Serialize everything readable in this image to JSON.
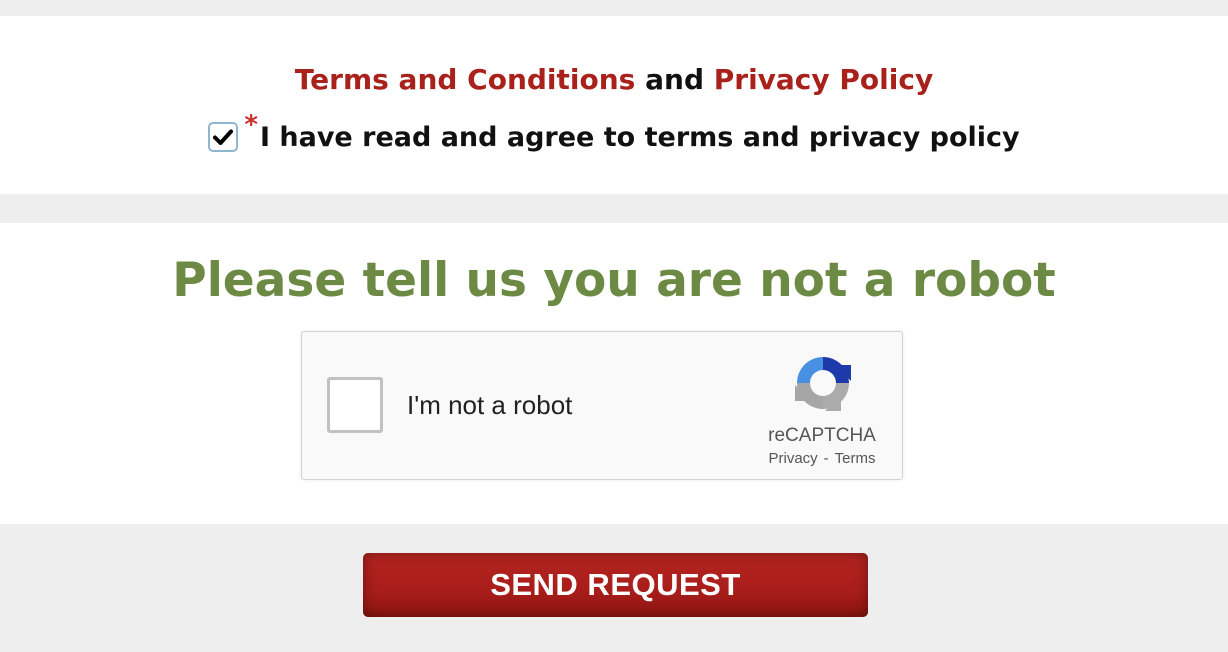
{
  "terms_section": {
    "terms_link": "Terms and Conditions",
    "conjunction": "and",
    "privacy_link": "Privacy Policy",
    "required_marker": "*",
    "agree_label": "I have read and agree to terms and privacy policy",
    "agree_checked": true
  },
  "robot_section": {
    "heading": "Please tell us you are not a robot",
    "recaptcha": {
      "label": "I'm not a robot",
      "brand": "reCAPTCHA",
      "privacy_link": "Privacy",
      "separator": "-",
      "terms_link": "Terms",
      "checked": false
    }
  },
  "submit": {
    "label": "SEND REQUEST"
  },
  "colors": {
    "link_red": "#a8211b",
    "heading_green": "#6c8a43",
    "button_red": "#a81d1a",
    "background": "#eeeeee"
  }
}
